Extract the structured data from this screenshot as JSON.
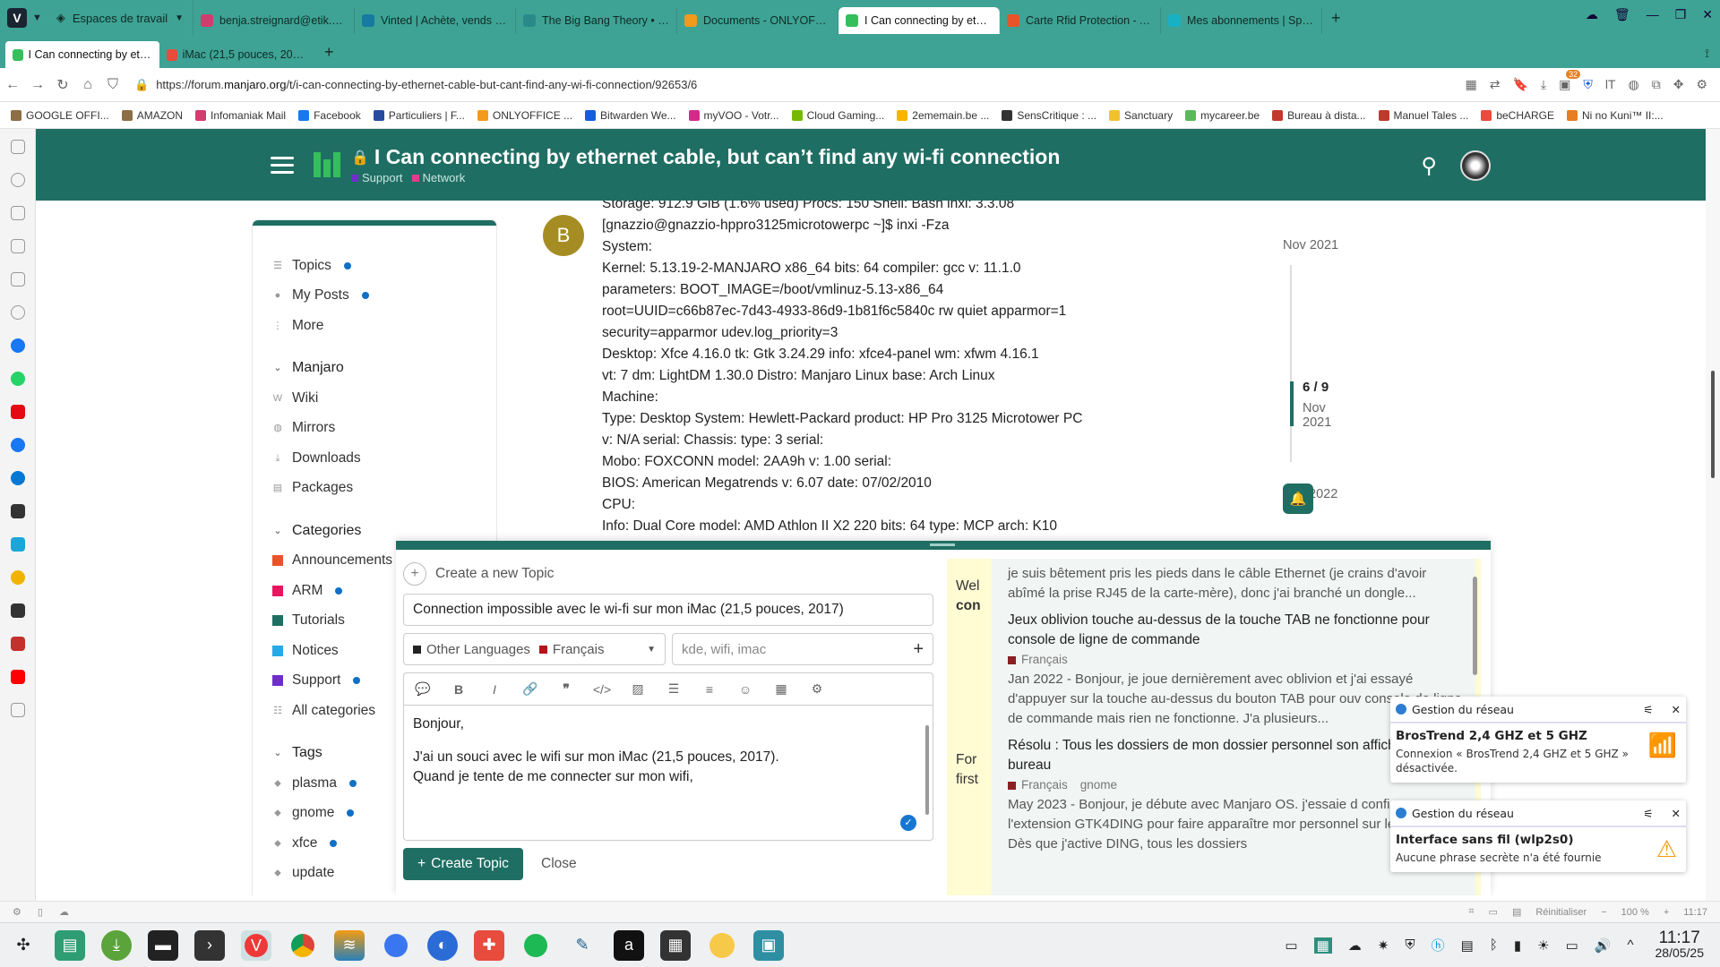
{
  "browser": {
    "workspace_label": "Espaces de travail",
    "tabs": [
      {
        "title": "benja.streignard@etik.com",
        "color": "#d33c6f"
      },
      {
        "title": "Vinted | Achète, vends ou...",
        "color": "#177aa0"
      },
      {
        "title": "The Big Bang Theory • H...",
        "color": "#2a8a8a"
      },
      {
        "title": "Documents - ONLYOFFICE",
        "color": "#f29a1c"
      },
      {
        "title": "I Can connecting by etherne",
        "color": "#35bf5c",
        "active": true
      },
      {
        "title": "Carte Rfid Protection - Al...",
        "color": "#e8542a"
      },
      {
        "title": "Mes abonnements | Spliiit",
        "color": "#1ab0c4"
      }
    ],
    "stack_tabs": [
      {
        "title": "I Can connecting by etherne",
        "active": true
      },
      {
        "title": "iMac (21,5 pouces, 2017) ...",
        "active": false
      }
    ],
    "url_prefix": "https://forum.",
    "url_host": "manjaro.org",
    "url_path": "/t/i-can-connecting-by-ethernet-cable-but-cant-find-any-wi-fi-connection/92653/6",
    "badge_count": "32",
    "bookmarks": [
      {
        "label": "GOOGLE OFFI...",
        "color": "#8d6e45"
      },
      {
        "label": "AMAZON",
        "color": "#8d6e45"
      },
      {
        "label": "Infomaniak Mail",
        "color": "#d33c6f"
      },
      {
        "label": "Facebook",
        "color": "#1877f2"
      },
      {
        "label": "Particuliers | F...",
        "color": "#274b9f"
      },
      {
        "label": "ONLYOFFICE ...",
        "color": "#f29a1c"
      },
      {
        "label": "Bitwarden We...",
        "color": "#175ddc"
      },
      {
        "label": "myVOO - Votr...",
        "color": "#d22c8a"
      },
      {
        "label": "Cloud Gaming...",
        "color": "#76b900"
      },
      {
        "label": "2ememain.be ...",
        "color": "#f7b500"
      },
      {
        "label": "SensCritique : ...",
        "color": "#333333"
      },
      {
        "label": "Sanctuary",
        "color": "#f2c12e"
      },
      {
        "label": "mycareer.be",
        "color": "#5cb85c"
      },
      {
        "label": "Bureau à dista...",
        "color": "#c0392b"
      },
      {
        "label": "Manuel Tales ...",
        "color": "#c0392b"
      },
      {
        "label": "beCHARGE",
        "color": "#e74c3c"
      },
      {
        "label": "Ni no Kuni™ II:...",
        "color": "#e67e22"
      }
    ]
  },
  "forum": {
    "topic_title": "I Can connecting by ethernet cable, but can’t find any wi-fi connection",
    "categories": [
      {
        "label": "Support",
        "color": "#6d2fc8"
      },
      {
        "label": "Network",
        "color": "#e43b8c"
      }
    ],
    "nav": {
      "main": [
        {
          "label": "Topics",
          "dot": true
        },
        {
          "label": "My Posts",
          "dot": true
        },
        {
          "label": "More",
          "dot": false
        }
      ],
      "manjaro_header": "Manjaro",
      "manjaro": [
        "Wiki",
        "Mirrors",
        "Downloads",
        "Packages"
      ],
      "categories_header": "Categories",
      "categories": [
        {
          "label": "Announcements",
          "color": "#e8542a",
          "dot": false
        },
        {
          "label": "ARM",
          "color": "#e8175d",
          "dot": true
        },
        {
          "label": "Tutorials",
          "color": "#1f6e63",
          "dot": false
        },
        {
          "label": "Notices",
          "color": "#27a9e3",
          "dot": false
        },
        {
          "label": "Support",
          "color": "#6d2fc8",
          "dot": true
        },
        {
          "label": "All categories",
          "color": "",
          "dot": false
        }
      ],
      "tags_header": "Tags",
      "tags": [
        {
          "label": "plasma",
          "dot": true
        },
        {
          "label": "gnome",
          "dot": true
        },
        {
          "label": "xfce",
          "dot": true
        },
        {
          "label": "update",
          "dot": false
        }
      ]
    },
    "post": {
      "avatar_letter": "B",
      "lines": [
        "Storage: 912.9 GiB (1.6% used) Procs: 150 Shell: Bash inxi: 3.3.08",
        "[gnazzio@gnazzio-hppro3125microtowerpc ~]$ inxi -Fza",
        "System:",
        "Kernel: 5.13.19-2-MANJARO x86_64 bits: 64 compiler: gcc v: 11.1.0",
        "parameters: BOOT_IMAGE=/boot/vmlinuz-5.13-x86_64",
        "root=UUID=c66b87ec-7d43-4933-86d9-1b81f6c5840c rw quiet apparmor=1",
        "security=apparmor udev.log_priority=3",
        "Desktop: Xfce 4.16.0 tk: Gtk 3.24.29 info: xfce4-panel wm: xfwm 4.16.1",
        "vt: 7 dm: LightDM 1.30.0 Distro: Manjaro Linux base: Arch Linux",
        "Machine:",
        "Type: Desktop System: Hewlett-Packard product: HP Pro 3125 Microtower PC",
        "v: N/A serial: Chassis: type: 3 serial:",
        "Mobo: FOXCONN model: 2AA9h v: 1.00 serial:",
        "BIOS: American Megatrends v: 6.07 date: 07/02/2010",
        "CPU:",
        "Info: Dual Core model: AMD Athlon II X2 220 bits: 64 type: MCP arch: K10"
      ]
    },
    "timeline": {
      "start_date": "Nov 2021",
      "position": "6 / 9",
      "position_date": "Nov 2021",
      "end_date": "Feb 2022"
    }
  },
  "composer": {
    "create_label": "Create a new Topic",
    "title_value": "Connection impossible avec le wi-fi sur mon iMac (21,5  pouces, 2017)",
    "category_parent": "Other Languages",
    "category_child": "Français",
    "tags_placeholder": "kde, wifi, imac",
    "body_line1": "Bonjour,",
    "body_line2": "J'ai un souci avec le wifi sur mon iMac (21,5 pouces, 2017).",
    "body_line3": "Quand je tente de me connecter sur mon wifi,",
    "create_button": "Create Topic",
    "close_button": "Close",
    "edge_text": [
      "Wel",
      "con",
      "For",
      "first"
    ],
    "similar": [
      {
        "title": "",
        "category": "",
        "tag": "",
        "excerpt": "je suis bêtement pris les pieds dans le câble Ethernet (je crains d'avoir abîmé la prise RJ45 de la carte-mère), donc j'ai branché un dongle..."
      },
      {
        "title": "Jeux oblivion touche au-dessus de la touche TAB ne fonctionne pour console de ligne de commande",
        "category": "Français",
        "tag": "",
        "excerpt": "Jan 2022 - Bonjour, je joue dernièrement avec oblivion et j'ai essayé d'appuyer sur la touche au-dessus du bouton TAB pour ouv console de ligne de commande mais rien ne fonctionne. J'a plusieurs..."
      },
      {
        "title": "Résolu : Tous les dossiers de mon dossier personnel son affichés sur le bureau",
        "category": "Français",
        "tag": "gnome",
        "excerpt": "May 2023 - Bonjour, je débute avec Manjaro OS. j'essaie d configurer l'extension GTK4DING pour faire apparaître mor personnel sur le \"bureau\". Dès que j'active DING, tous les dossiers"
      }
    ]
  },
  "notifications": [
    {
      "app": "Gestion du réseau",
      "title": "BrosTrend 2,4 GHZ et 5 GHZ",
      "message": "Connexion « BrosTrend 2,4 GHZ et 5 GHZ » désactivée."
    },
    {
      "app": "Gestion du réseau",
      "title": "Interface sans fil (wlp2s0)",
      "message": "Aucune phrase secrète n'a été fournie"
    }
  ],
  "statusbar": {
    "reset": "Réinitialiser",
    "zoom": "100 %",
    "time": "11:17"
  },
  "taskbar": {
    "time": "11:17",
    "date": "28/05/25"
  }
}
